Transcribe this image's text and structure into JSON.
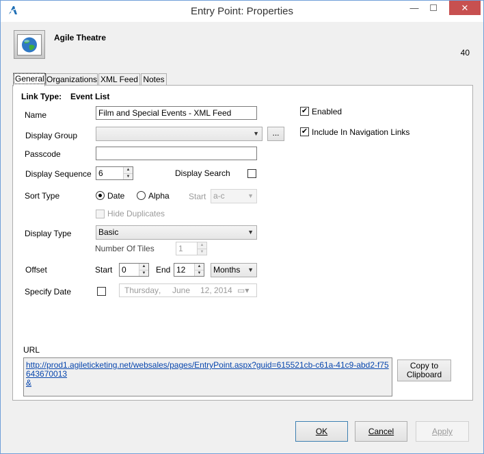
{
  "window": {
    "title": "Entry Point: Properties",
    "controls": {
      "minimize": "—",
      "maximize": "☐",
      "close": "✕"
    }
  },
  "header": {
    "title": "Agile Theatre",
    "id": "40"
  },
  "tabs": [
    {
      "label": "General",
      "active": true
    },
    {
      "label": "Organizations",
      "active": false
    },
    {
      "label": "XML Feed",
      "active": false
    },
    {
      "label": "Notes",
      "active": false
    }
  ],
  "general": {
    "link_type_label": "Link Type:",
    "link_type_value": "Event List",
    "name_label": "Name",
    "name_value": "Film and Special Events - XML Feed",
    "display_group_label": "Display Group",
    "display_group_value": "",
    "browse_label": "...",
    "passcode_label": "Passcode",
    "passcode_value": "",
    "display_sequence_label": "Display Sequence",
    "display_sequence_value": "6",
    "display_search_label": "Display Search",
    "display_search_checked": false,
    "enabled_label": "Enabled",
    "enabled_checked": true,
    "include_nav_label": "Include In Navigation Links",
    "include_nav_checked": true,
    "sort_type_label": "Sort Type",
    "sort_date_label": "Date",
    "sort_alpha_label": "Alpha",
    "sort_selected": "Date",
    "start_label": "Start",
    "start_value": "a-c",
    "hide_duplicates_label": "Hide Duplicates",
    "display_type_label": "Display Type",
    "display_type_value": "Basic",
    "number_of_tiles_label": "Number Of Tiles",
    "number_of_tiles_value": "1",
    "offset_label": "Offset",
    "offset_start_label": "Start",
    "offset_start_value": "0",
    "offset_end_label": "End",
    "offset_end_value": "12",
    "offset_unit_value": "Months",
    "specify_date_label": "Specify Date",
    "specify_date_checked": false,
    "date_weekday": "Thursday",
    "date_sep": ",",
    "date_month": "June",
    "date_daynum": "12, 2014",
    "url_label": "URL",
    "url_value": "http://prod1.agileticketing.net/websales/pages/EntryPoint.aspx?guid=615521cb-c61a-41c9-abd2-f75643670013",
    "url_tail": "&",
    "copy_label_1": "Copy to",
    "copy_label_2": "Clipboard"
  },
  "footer": {
    "ok_label": "OK",
    "cancel_label": "Cancel",
    "apply_label": "Apply"
  },
  "colors": {
    "accent": "#3c7fb1",
    "close_button": "#c75050",
    "link": "#0645ad"
  }
}
